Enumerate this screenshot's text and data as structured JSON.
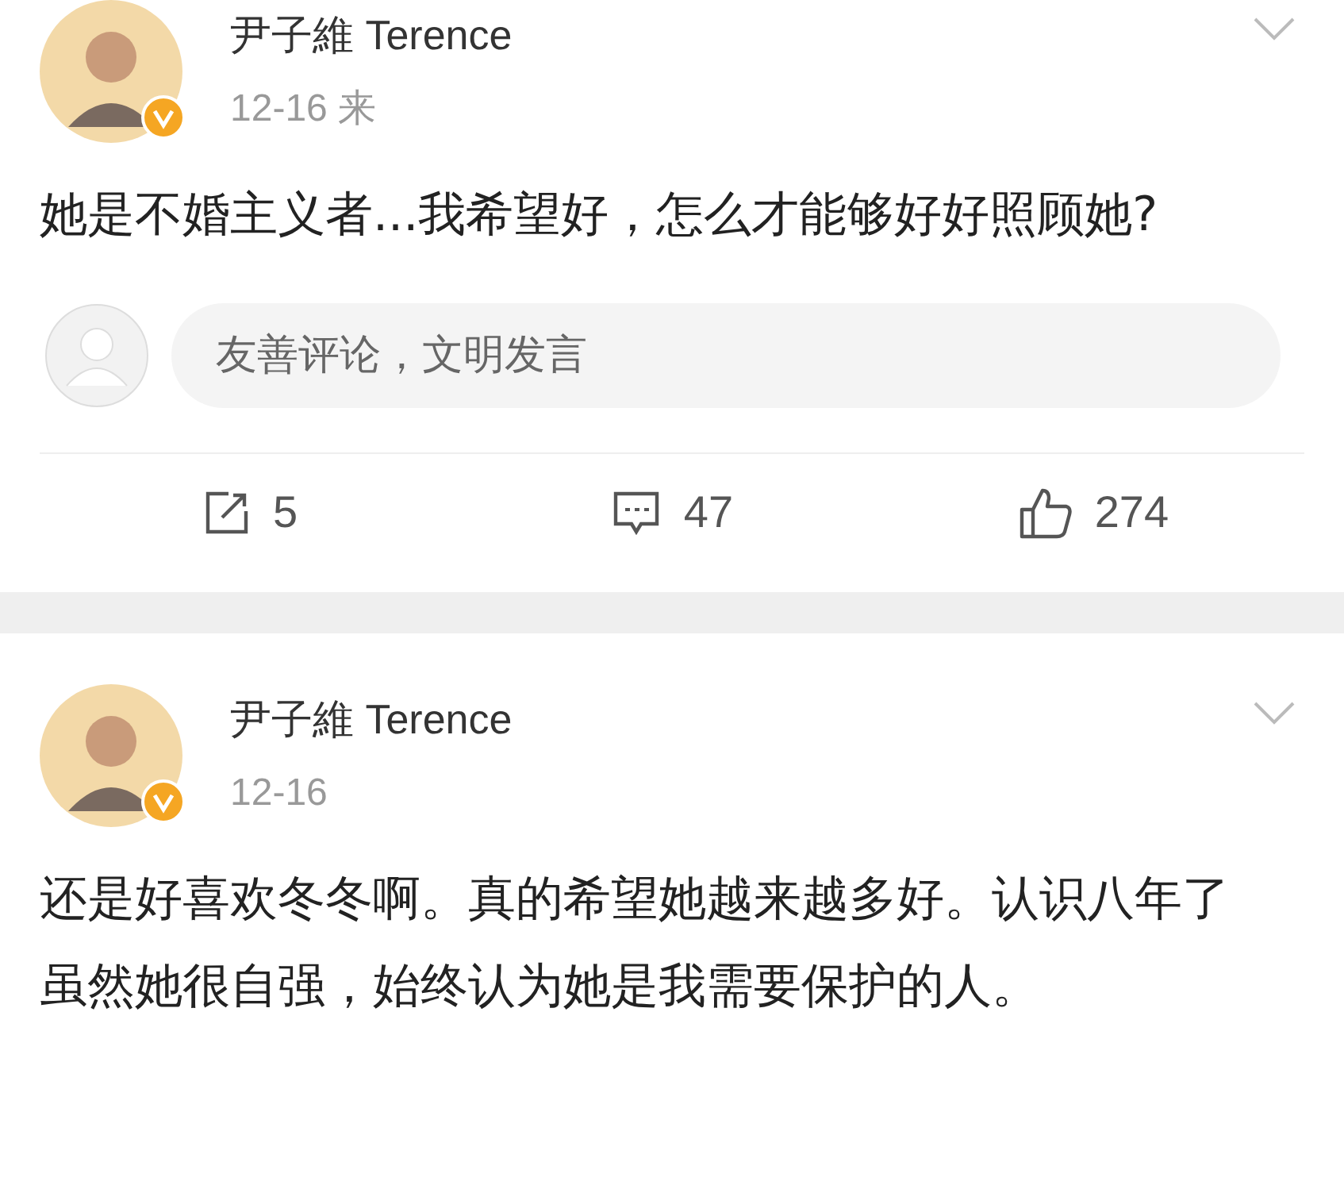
{
  "posts": [
    {
      "author": "尹子維 Terence",
      "time": "12-16 来",
      "text": "她是不婚主义者...我希望好，怎么才能够好好照顾她?",
      "comment_box": {
        "placeholder": "友善评论，文明发言"
      },
      "actions": [
        {
          "kind": "repost",
          "count": "5"
        },
        {
          "kind": "comment",
          "count": "47"
        },
        {
          "kind": "like",
          "count": "274"
        }
      ]
    },
    {
      "author": "尹子維 Terence",
      "time": "12-16",
      "text": "还是好喜欢冬冬啊。真的希望她越来越多好。认识八年了虽然她很自强，始终认为她是我需要保护的人。"
    }
  ]
}
